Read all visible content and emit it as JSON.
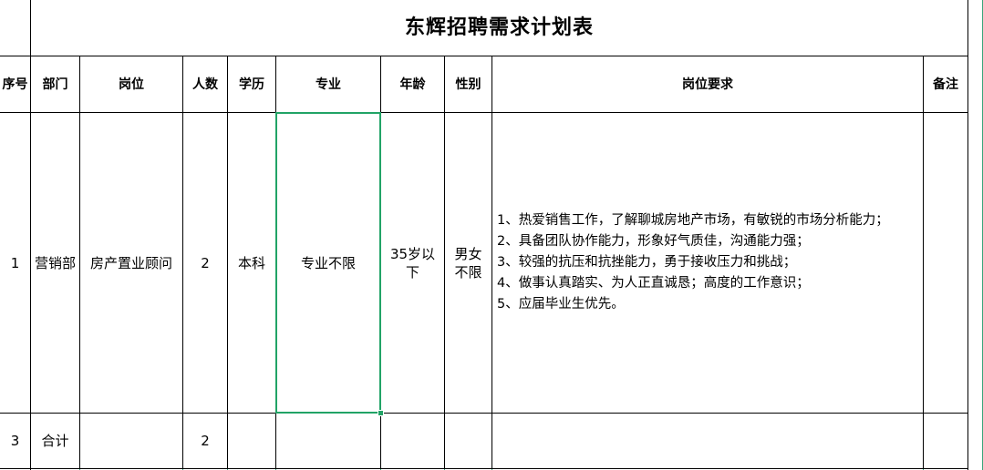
{
  "sheet": {
    "title": "东辉招聘需求计划表",
    "headers": [
      "序号",
      "部门",
      "岗位",
      "人数",
      "学历",
      "专业",
      "年龄",
      "性别",
      "岗位要求",
      "备注"
    ],
    "row1": {
      "index": "1",
      "department": "营销部",
      "position": "房产置业顾问",
      "count": "2",
      "education": "本科",
      "major": "专业不限",
      "age": "35岁以下",
      "gender": "男女不限",
      "requirements": [
        "1、热爱销售工作，了解聊城房地产市场，有敏锐的市场分析能力；",
        "2、具备团队协作能力，形象好气质佳，沟通能力强；",
        "3、较强的抗压和抗挫能力，勇于接收压力和挑战；",
        "4、做事认真踏实、为人正直诚恳；高度的工作意识；",
        "5、应届毕业生优先。"
      ],
      "remark": ""
    },
    "total_row": {
      "index": "3",
      "label": "合计",
      "count": "2"
    }
  }
}
